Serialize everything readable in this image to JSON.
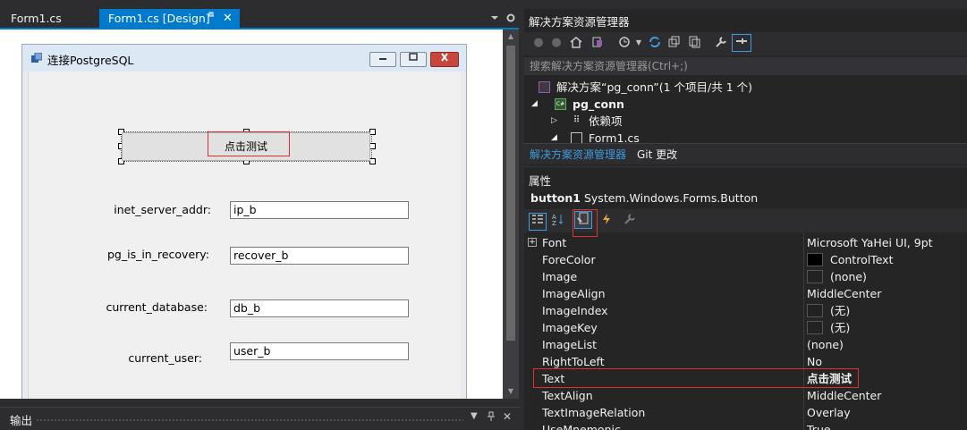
{
  "tabs": {
    "code_tab": "Form1.cs",
    "design_tab": "Form1.cs [Design]",
    "pin_glyph": "⊿",
    "close_glyph": "✕"
  },
  "form": {
    "title": "连接PostgreSQL",
    "button_text": "点击测试",
    "fields": [
      {
        "label": "inet_server_addr:",
        "value": "ip_b"
      },
      {
        "label": "pg_is_in_recovery:",
        "value": "recover_b"
      },
      {
        "label": "current_database:",
        "value": "db_b"
      },
      {
        "label": "current_user:",
        "value": "user_b"
      }
    ]
  },
  "output_panel": {
    "title": "输出"
  },
  "solution_explorer": {
    "title": "解决方案资源管理器",
    "search_placeholder": "搜索解决方案资源管理器(Ctrl+;)",
    "tree": [
      {
        "text": "解决方案“pg_conn”(1 个项目/共 1 个)",
        "bold": false
      },
      {
        "text": "pg_conn",
        "bold": true
      },
      {
        "text": "依赖项",
        "bold": false
      },
      {
        "text": "Form1.cs",
        "bold": false
      }
    ],
    "bottom_tabs": [
      "解决方案资源管理器",
      "Git 更改"
    ]
  },
  "properties": {
    "title": "属性",
    "object_name": "button1",
    "object_type": "System.Windows.Forms.Button",
    "rows": [
      {
        "name": "Font",
        "value": "Microsoft YaHei UI, 9pt"
      },
      {
        "name": "ForeColor",
        "value": "ControlText"
      },
      {
        "name": "Image",
        "value": "(none)"
      },
      {
        "name": "ImageAlign",
        "value": "MiddleCenter"
      },
      {
        "name": "ImageIndex",
        "value": "(无)"
      },
      {
        "name": "ImageKey",
        "value": "(无)"
      },
      {
        "name": "ImageList",
        "value": "(none)"
      },
      {
        "name": "RightToLeft",
        "value": "No"
      },
      {
        "name": "Text",
        "value": "点击测试"
      },
      {
        "name": "TextAlign",
        "value": "MiddleCenter"
      },
      {
        "name": "TextImageRelation",
        "value": "Overlay"
      },
      {
        "name": "UseMnemonic",
        "value": "True"
      }
    ]
  },
  "colors": {
    "accent": "#007acc",
    "highlight_red": "#e03030",
    "ide_background": "#2d2d30"
  }
}
